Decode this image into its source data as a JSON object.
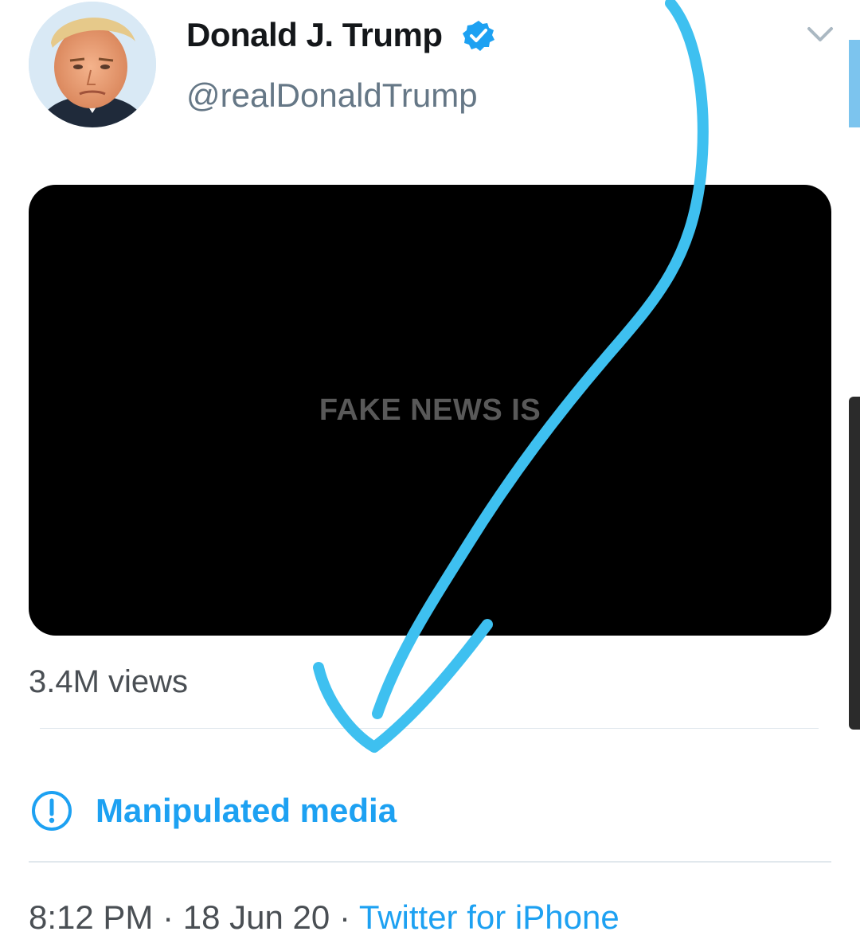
{
  "tweet": {
    "author_name": "Donald J. Trump",
    "handle": "@realDonaldTrump",
    "verified_icon": "verified-badge-icon",
    "menu_icon": "chevron-down-icon",
    "video_caption": "FAKE NEWS IS",
    "views": "3.4M views",
    "notice": {
      "icon": "exclamation-circle-icon",
      "label": "Manipulated media"
    },
    "time": "8:12 PM",
    "date": "18 Jun 20",
    "separator": "·",
    "source": "Twitter for iPhone"
  },
  "colors": {
    "accent": "#1da1f2",
    "annotation": "#3ec0f0",
    "secondary_text": "#657786"
  }
}
